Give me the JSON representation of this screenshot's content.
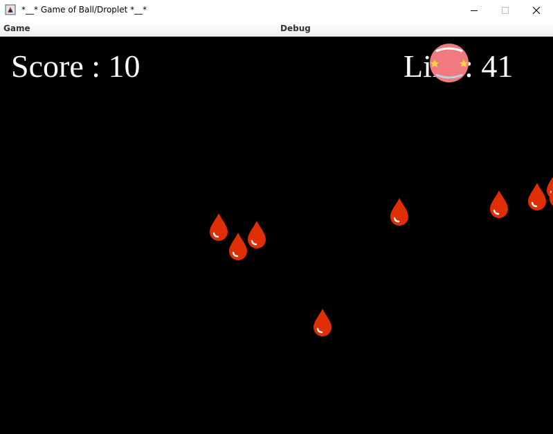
{
  "window": {
    "title": "*__* Game of Ball/Droplet *__*",
    "icons": [
      "app-icon",
      "minimize-icon",
      "maximize-icon",
      "close-icon"
    ]
  },
  "menu": {
    "items": [
      "Game",
      "Debug"
    ]
  },
  "hud": {
    "score_text": "Score : 10",
    "life_text": "Life : 41"
  },
  "game": {
    "background": "#000000",
    "droplet_color": "#e02e06",
    "ball_color": "#f07a80",
    "droplet_count": 11,
    "icons": [
      "ball-icon",
      "droplet-icon"
    ]
  }
}
